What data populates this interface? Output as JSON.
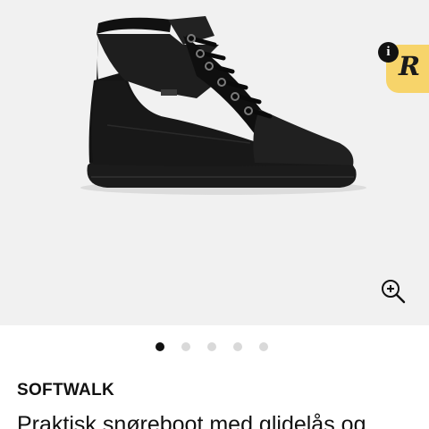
{
  "badge": {
    "info_symbol": "i",
    "letter": "R"
  },
  "gallery": {
    "image": "black-lace-up-hiking-boot",
    "zoom_icon": "zoom-in-icon",
    "dots_total": 5,
    "dots_active_index": 0
  },
  "product": {
    "brand": "SOFTWALK",
    "title": "Praktisk snøreboot med glidelås og"
  }
}
